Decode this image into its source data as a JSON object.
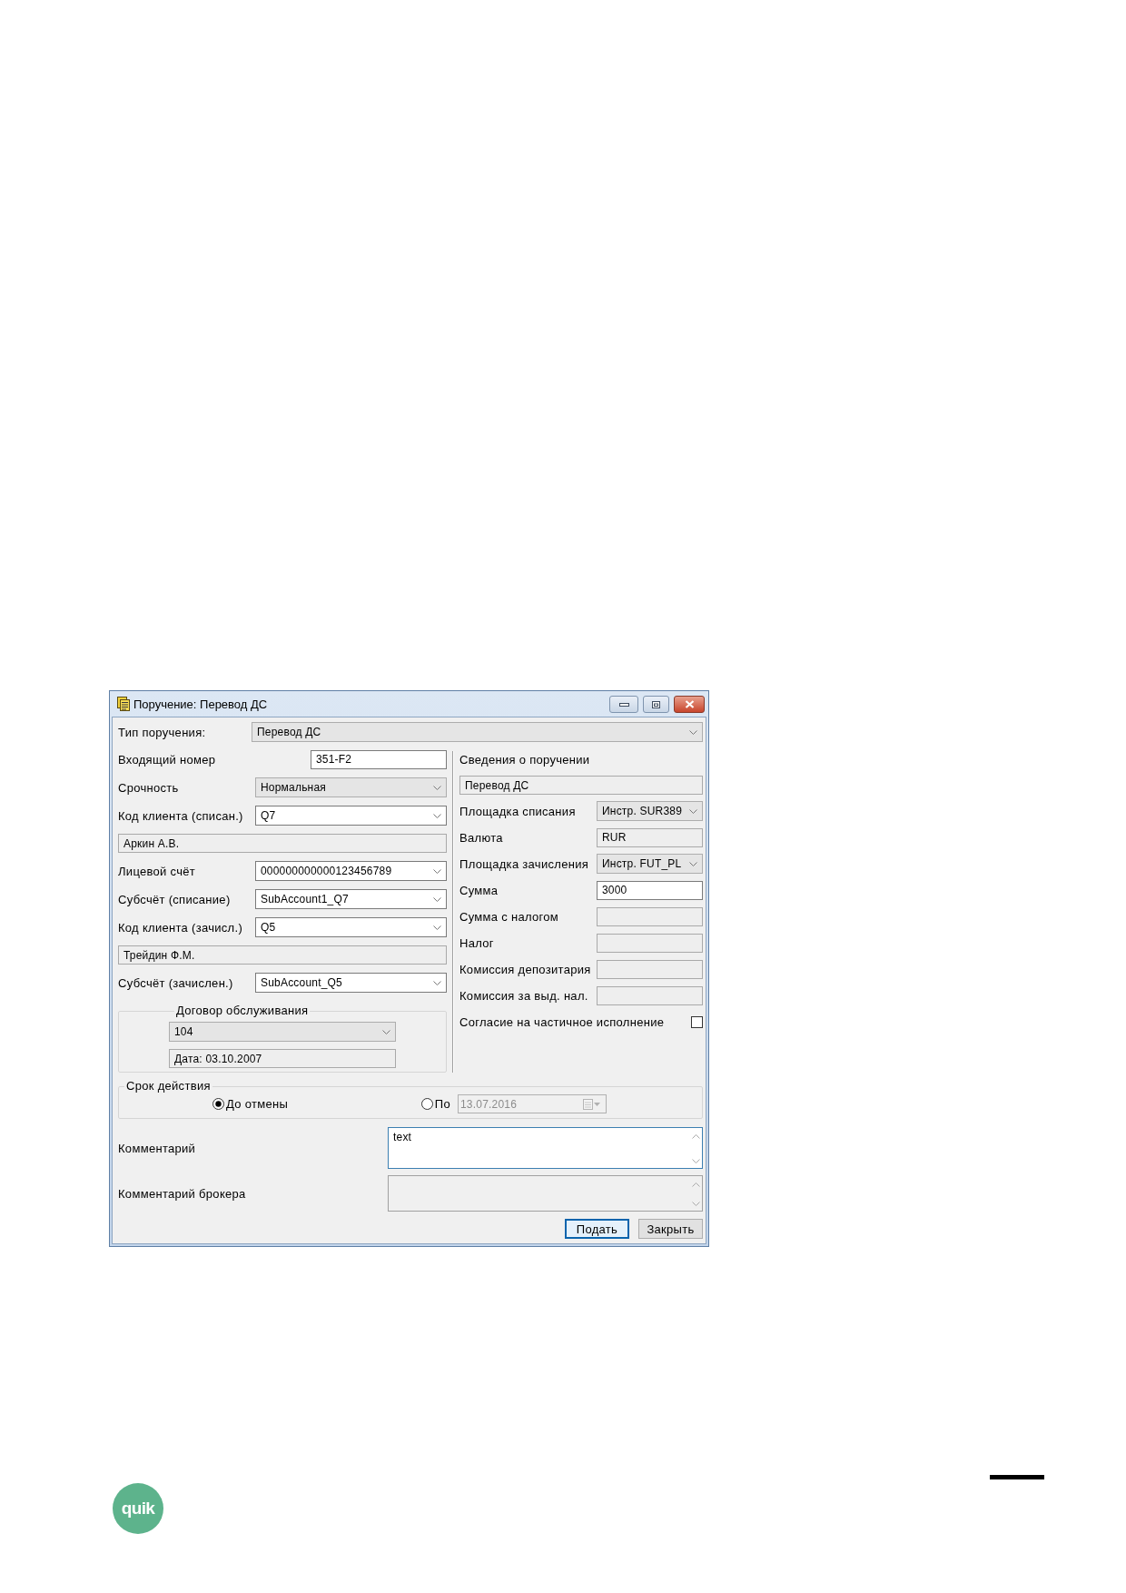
{
  "window": {
    "title": "Поручение: Перевод ДС"
  },
  "order_type": {
    "label": "Тип поручения:",
    "value": "Перевод ДС",
    "readonly": true
  },
  "left_fields": [
    {
      "kind": "text",
      "label": "Входящий номер",
      "value": "351-F2",
      "readonly": false
    },
    {
      "kind": "combo",
      "label": "Срочность",
      "value": "Нормальная",
      "readonly": true
    },
    {
      "kind": "combo",
      "label": "Код клиента (списан.)",
      "value": "Q7",
      "readonly": false
    },
    {
      "kind": "name",
      "value": "Аркин А.В.",
      "readonly": true
    },
    {
      "kind": "combo",
      "label": "Лицевой счёт",
      "value": "000000000000123456789",
      "readonly": false
    },
    {
      "kind": "combo",
      "label": "Субсчёт (списание)",
      "value": "SubAccount1_Q7",
      "readonly": false
    },
    {
      "kind": "combo",
      "label": "Код клиента (зачисл.)",
      "value": "Q5",
      "readonly": false
    },
    {
      "kind": "name",
      "value": "Трейдин Ф.М.",
      "readonly": true
    },
    {
      "kind": "combo",
      "label": "Субсчёт (зачислен.)",
      "value": "SubAccount_Q5",
      "readonly": false
    }
  ],
  "service_agreement": {
    "label": "Договор обслуживания",
    "contract": {
      "value": "104",
      "readonly": true
    },
    "date": {
      "value": "Дата: 03.10.2007",
      "readonly": true
    }
  },
  "order_info": {
    "label": "Сведения о поручении",
    "value": "Перевод ДС",
    "readonly": true
  },
  "right_fields": [
    {
      "kind": "combo",
      "label": "Площадка списания",
      "value": "Инстр. SUR389",
      "readonly": true
    },
    {
      "kind": "text",
      "label": "Валюта",
      "value": "RUR",
      "readonly": true
    },
    {
      "kind": "combo",
      "label": "Площадка зачисления",
      "value": "Инстр. FUT_PL",
      "readonly": true
    },
    {
      "kind": "text",
      "label": "Сумма",
      "value": "3000",
      "readonly": false
    },
    {
      "kind": "text",
      "label": "Сумма с налогом",
      "readonly": true
    },
    {
      "kind": "text",
      "label": "Налог",
      "readonly": true
    },
    {
      "kind": "text",
      "label": "Комиссия депозитария",
      "readonly": true
    },
    {
      "kind": "text",
      "label": "Комиссия за выд. нал.",
      "readonly": true
    },
    {
      "kind": "checkbox",
      "label": "Согласие на частичное исполнение",
      "checked": false
    }
  ],
  "validity": {
    "label": "Срок действия",
    "options": [
      {
        "label": "До отмены",
        "selected": true
      },
      {
        "label": "По",
        "selected": false,
        "date": {
          "value": "13.07.2016",
          "disabled": true
        }
      }
    ]
  },
  "comment": {
    "label": "Комментарий",
    "value": "text",
    "focused": true
  },
  "broker_comment": {
    "label": "Комментарий брокера",
    "readonly": true
  },
  "buttons": [
    {
      "label": "Подать",
      "default": true
    },
    {
      "label": "Закрыть",
      "default": false
    }
  ],
  "logo": {
    "text": "quik"
  }
}
